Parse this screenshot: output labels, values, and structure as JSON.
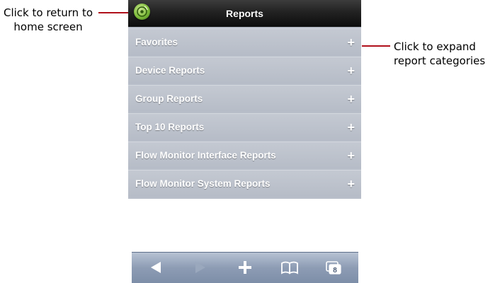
{
  "annotations": {
    "home": "Click to return to home screen",
    "expand": "Click to expand report categories"
  },
  "header": {
    "title": "Reports",
    "home_icon": "home-icon"
  },
  "report_categories": [
    {
      "label": "Favorites",
      "expand": "+"
    },
    {
      "label": "Device Reports",
      "expand": "+"
    },
    {
      "label": "Group Reports",
      "expand": "+"
    },
    {
      "label": "Top 10 Reports",
      "expand": "+"
    },
    {
      "label": "Flow Monitor Interface Reports",
      "expand": "+"
    },
    {
      "label": "Flow Monitor System Reports",
      "expand": "+"
    }
  ],
  "toolbar": {
    "tabs_count": "8",
    "icons": [
      "back-arrow-icon",
      "forward-arrow-icon",
      "add-icon",
      "bookmarks-icon",
      "tabs-icon"
    ]
  },
  "colors": {
    "callout_line": "#b0101b",
    "row_background": "#b8bec9",
    "header_background": "#1a1a1a"
  }
}
